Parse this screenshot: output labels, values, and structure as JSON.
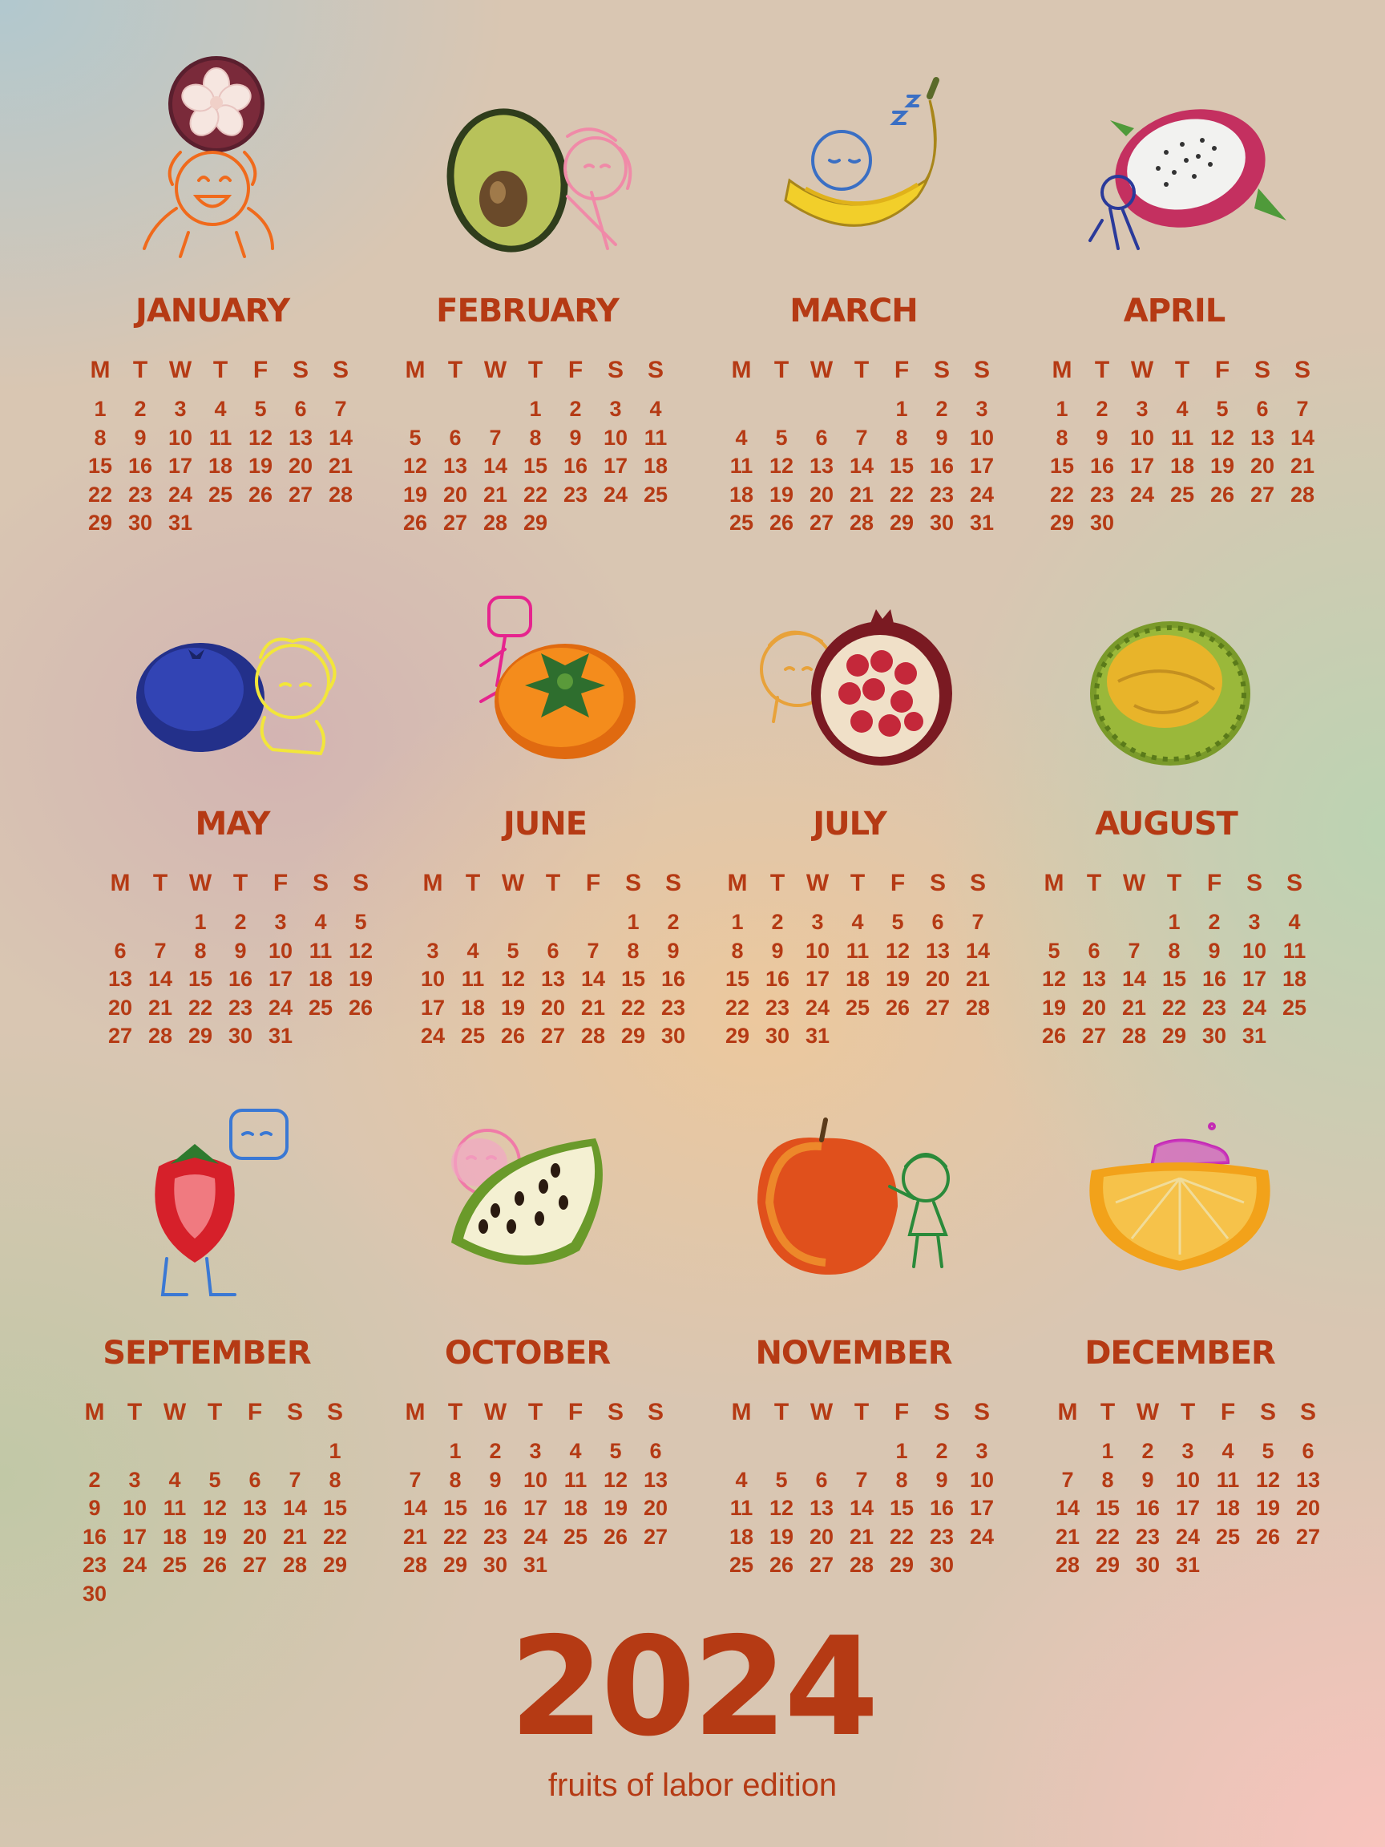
{
  "weekday_headers": [
    "M",
    "T",
    "W",
    "T",
    "F",
    "S",
    "S"
  ],
  "months": [
    {
      "name": "JANUARY",
      "fruit": "mangosteen-icon",
      "offset": 0,
      "days": 31
    },
    {
      "name": "FEBRUARY",
      "fruit": "avocado-icon",
      "offset": 3,
      "days": 29
    },
    {
      "name": "MARCH",
      "fruit": "banana-icon",
      "offset": 4,
      "days": 31
    },
    {
      "name": "APRIL",
      "fruit": "dragon-fruit-icon",
      "offset": 0,
      "days": 30
    },
    {
      "name": "MAY",
      "fruit": "blueberry-icon",
      "offset": 2,
      "days": 31
    },
    {
      "name": "JUNE",
      "fruit": "persimmon-icon",
      "offset": 5,
      "days": 30
    },
    {
      "name": "JULY",
      "fruit": "pomegranate-icon",
      "offset": 0,
      "days": 31
    },
    {
      "name": "AUGUST",
      "fruit": "durian-icon",
      "offset": 3,
      "days": 31
    },
    {
      "name": "SEPTEMBER",
      "fruit": "strawberry-icon",
      "offset": 6,
      "days": 30
    },
    {
      "name": "OCTOBER",
      "fruit": "soursop-icon",
      "offset": 1,
      "days": 31
    },
    {
      "name": "NOVEMBER",
      "fruit": "apple-icon",
      "offset": 4,
      "days": 30
    },
    {
      "name": "DECEMBER",
      "fruit": "orange-segment-icon",
      "offset": 1,
      "days": 31
    }
  ],
  "year": "2024",
  "subtitle": "fruits of labor edition",
  "colors": {
    "text": "#b53a14"
  }
}
